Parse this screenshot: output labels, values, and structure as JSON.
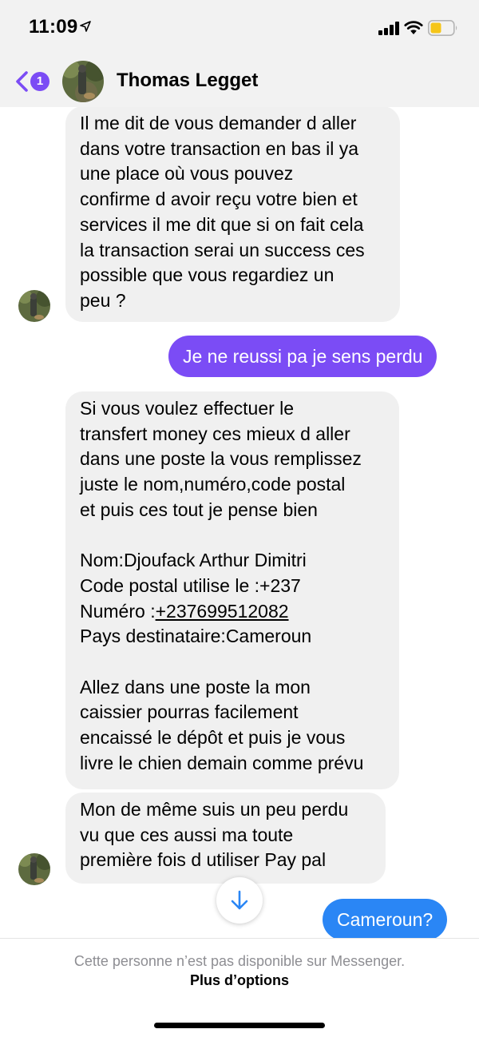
{
  "status_bar": {
    "time": "11:09",
    "icons": [
      "location-arrow-icon",
      "signal-icon",
      "wifi-icon",
      "battery-icon"
    ],
    "battery_color": "#f5c518"
  },
  "header": {
    "back_badge": "1",
    "contact_name": "Thomas Legget",
    "accent_color": "#7b4cf5"
  },
  "messages": {
    "m1": {
      "sender": "contact",
      "lines": [
        "Il me dit de vous demander d aller",
        "dans votre transaction en bas il ya",
        "une place où vous pouvez",
        "confirme d avoir reçu votre bien et",
        "services il me dit que si on fait cela",
        "la transaction serai un success ces",
        "possible que vous regardiez un",
        "peu ?"
      ]
    },
    "m2": {
      "sender": "me",
      "text": "Je ne reussi pa je sens perdu"
    },
    "m3": {
      "sender": "contact",
      "lines": [
        "Si vous voulez effectuer le",
        "transfert money ces mieux d aller",
        "dans une poste la vous remplissez",
        "juste le nom,numéro,code postal",
        "et puis ces tout je pense bien",
        "",
        "Nom:Djoufack Arthur Dimitri",
        "Code postal utilise le :+237",
        "",
        "Pays destinataire:Cameroun",
        "",
        "Allez dans une poste la mon",
        "caissier pourras facilement",
        "encaissé le dépôt et puis je vous",
        "livre le chien demain comme prévu"
      ],
      "phone_label": "Numéro :",
      "phone_link": "+237699512082"
    },
    "m4": {
      "sender": "contact",
      "lines": [
        "Mon de même suis un peu perdu",
        "vu que ces aussi ma toute",
        "première fois d utiliser Pay pal"
      ]
    },
    "m5": {
      "sender": "me",
      "text": "Cameroun?"
    }
  },
  "scroll_down_icon": "arrow-down-icon",
  "footer": {
    "note": "Cette personne n’est pas disponible sur Messenger.",
    "more_options": "Plus d’options"
  }
}
